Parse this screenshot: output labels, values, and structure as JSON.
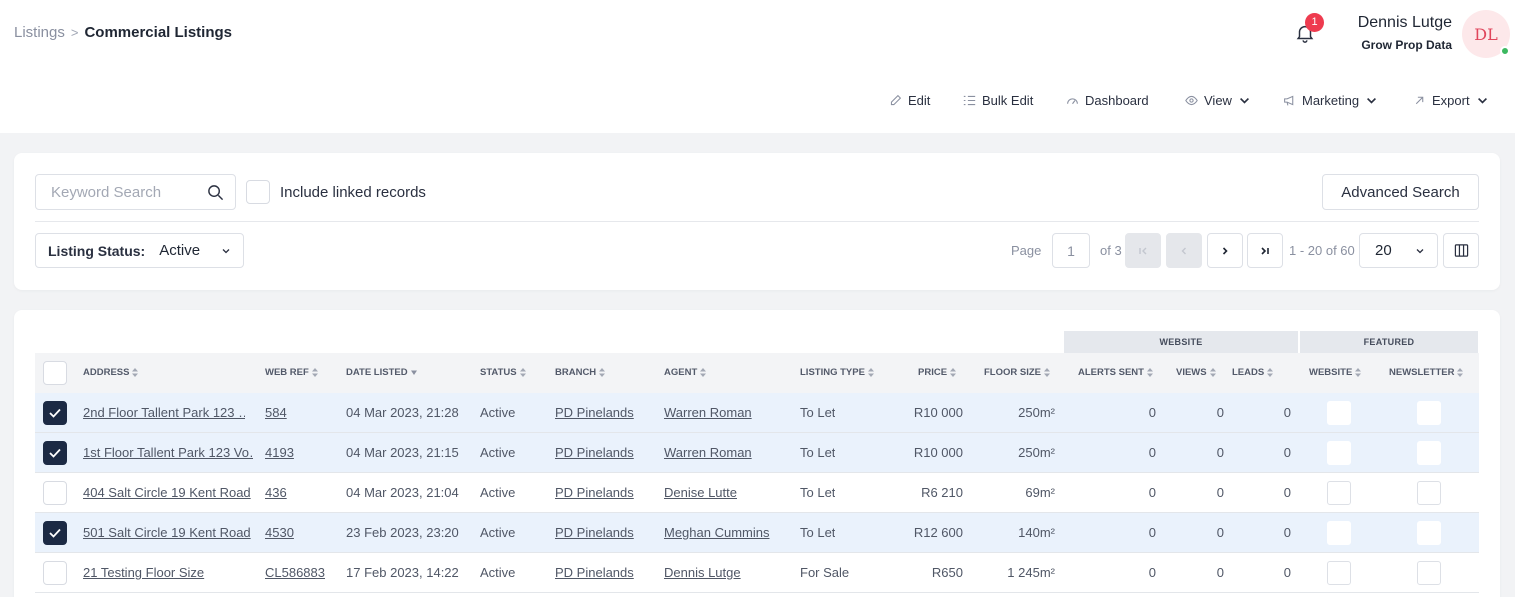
{
  "breadcrumb": {
    "parent": "Listings",
    "current": "Commercial Listings"
  },
  "notifications": {
    "count": "1"
  },
  "user": {
    "name": "Dennis Lutge",
    "org": "Grow Prop Data",
    "initials": "DL"
  },
  "toolbar": {
    "edit": "Edit",
    "bulk_edit": "Bulk Edit",
    "dashboard": "Dashboard",
    "view": "View",
    "marketing": "Marketing",
    "export": "Export"
  },
  "search": {
    "placeholder": "Keyword Search",
    "include_linked": "Include linked records",
    "advanced": "Advanced Search"
  },
  "filter": {
    "label": "Listing Status:",
    "value": "Active"
  },
  "pagination": {
    "page_label": "Page",
    "page": "1",
    "of": "of 3",
    "range": "1 - 20 of 60",
    "page_size": "20"
  },
  "table": {
    "groups": {
      "website": "WEBSITE",
      "featured": "FEATURED"
    },
    "headers": {
      "address": "ADDRESS",
      "web_ref": "WEB REF",
      "date_listed": "DATE LISTED",
      "status": "STATUS",
      "branch": "BRANCH",
      "agent": "AGENT",
      "listing_type": "LISTING TYPE",
      "price": "PRICE",
      "floor_size": "FLOOR SIZE",
      "alerts_sent": "ALERTS SENT",
      "views": "VIEWS",
      "leads": "LEADS",
      "website": "WEBSITE",
      "newsletter": "NEWSLETTER"
    },
    "rows": [
      {
        "address": "2nd Floor Tallent Park 123 …",
        "web_ref": "584",
        "date": "04 Mar 2023, 21:28",
        "status": "Active",
        "branch": "PD Pinelands",
        "agent": "Warren Roman",
        "type": "To Let",
        "price": "R10 000",
        "floor": "250m²",
        "alerts": "0",
        "views": "0",
        "leads": "0"
      },
      {
        "address": "1st Floor Tallent Park 123 Vo…",
        "web_ref": "4193",
        "date": "04 Mar 2023, 21:15",
        "status": "Active",
        "branch": "PD Pinelands",
        "agent": "Warren Roman",
        "type": "To Let",
        "price": "R10 000",
        "floor": "250m²",
        "alerts": "0",
        "views": "0",
        "leads": "0"
      },
      {
        "address": "404 Salt Circle 19 Kent Road",
        "web_ref": "436",
        "date": "04 Mar 2023, 21:04",
        "status": "Active",
        "branch": "PD Pinelands",
        "agent": "Denise Lutte",
        "type": "To Let",
        "price": "R6 210",
        "floor": "69m²",
        "alerts": "0",
        "views": "0",
        "leads": "0"
      },
      {
        "address": "501 Salt Circle 19 Kent Road",
        "web_ref": "4530",
        "date": "23 Feb 2023, 23:20",
        "status": "Active",
        "branch": "PD Pinelands",
        "agent": "Meghan Cummins",
        "type": "To Let",
        "price": "R12 600",
        "floor": "140m²",
        "alerts": "0",
        "views": "0",
        "leads": "0"
      },
      {
        "address": "21 Testing Floor Size",
        "web_ref": "CL586883",
        "date": "17 Feb 2023, 14:22",
        "status": "Active",
        "branch": "PD Pinelands",
        "agent": "Dennis Lutge",
        "type": "For Sale",
        "price": "R650",
        "floor": "1 245m²",
        "alerts": "0",
        "views": "0",
        "leads": "0"
      }
    ]
  },
  "colors": {
    "accent": "#1c2a44",
    "selected_row": "#eaf2fc",
    "badge": "#ee3b4f",
    "online": "#3cb860"
  }
}
